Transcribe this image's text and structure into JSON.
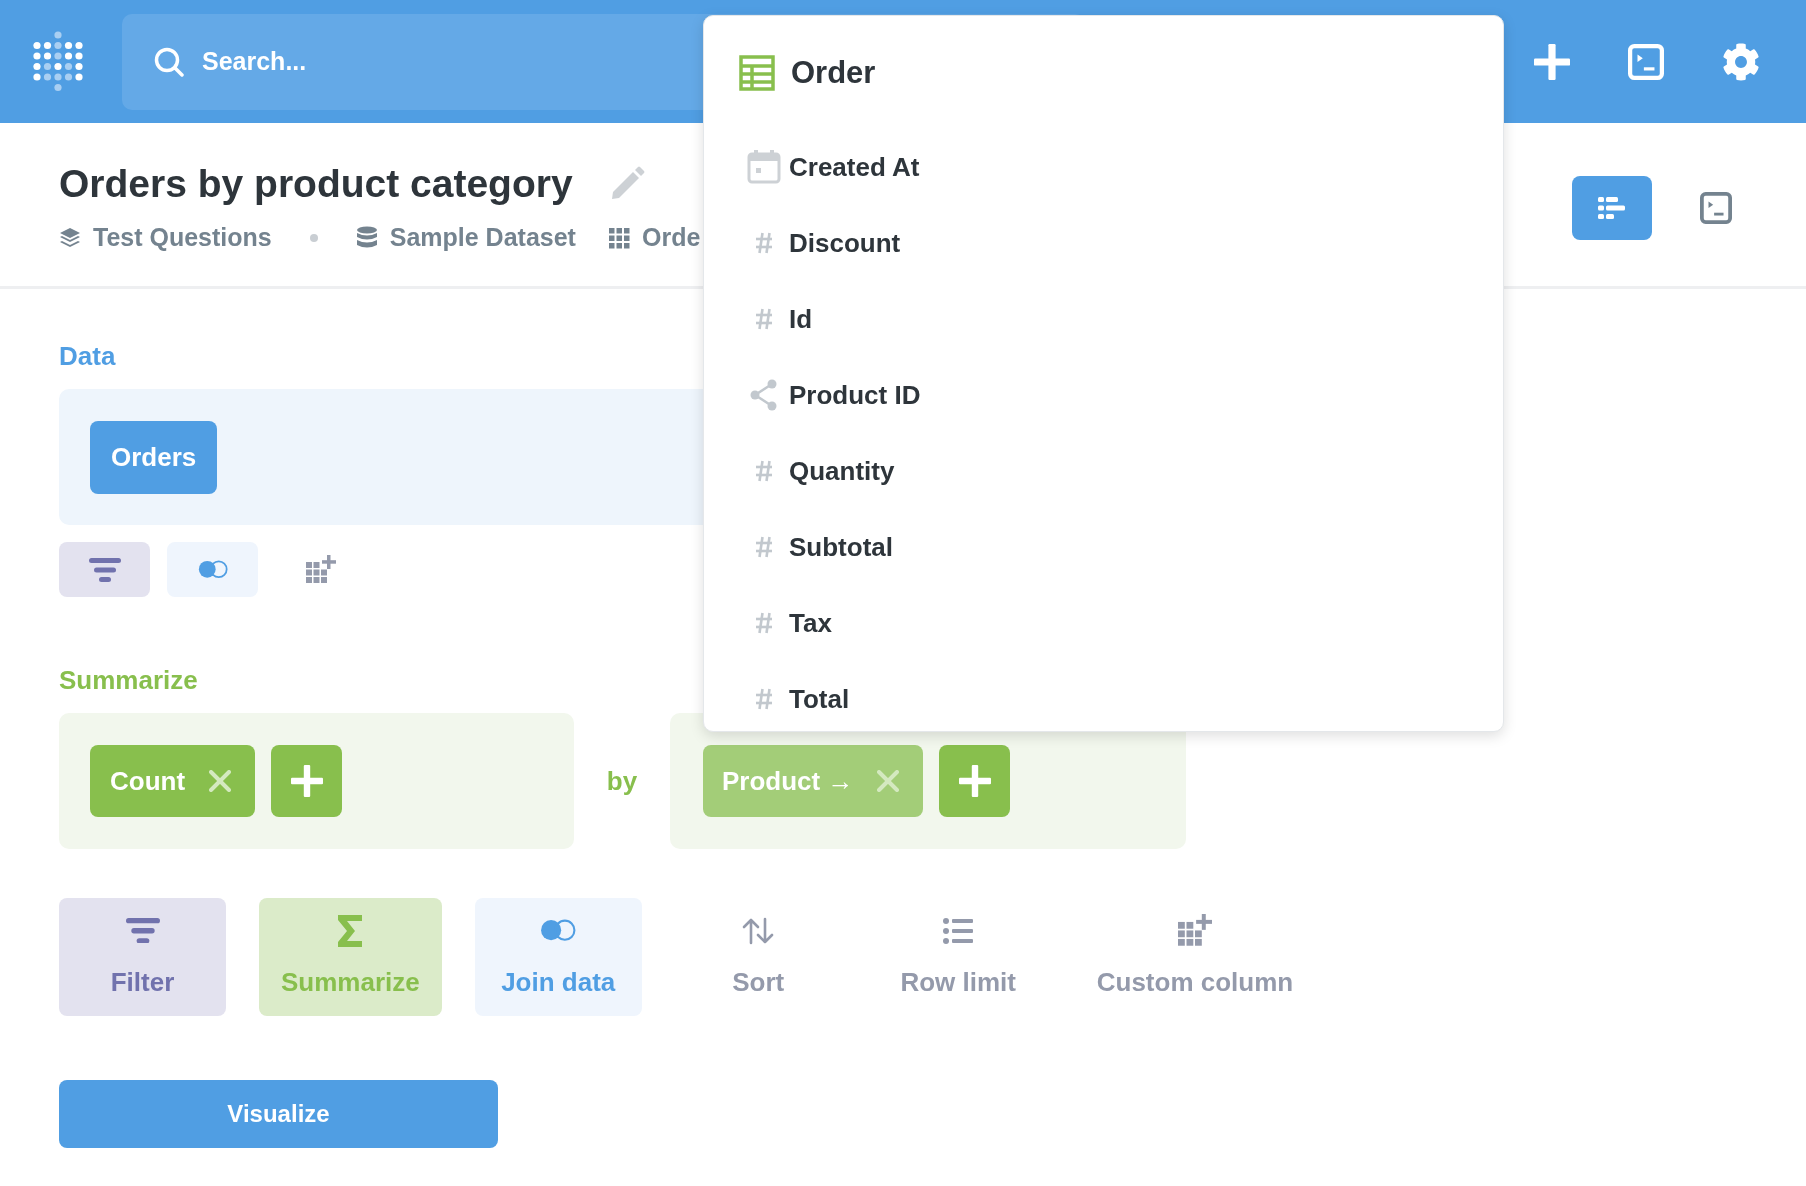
{
  "header": {
    "search": {
      "placeholder": "Search..."
    }
  },
  "question": {
    "title": "Orders by product category",
    "breadcrumbs": [
      {
        "kind": "collection",
        "label": "Test Questions"
      },
      {
        "kind": "database",
        "label": "Sample Dataset"
      },
      {
        "kind": "table",
        "label": "Orde"
      }
    ]
  },
  "view_toggle": [
    {
      "kind": "notebook",
      "selected": true
    },
    {
      "kind": "sql",
      "selected": false
    }
  ],
  "data": {
    "label": "Data",
    "source": "Orders",
    "steps": [
      {
        "kind": "filter"
      },
      {
        "kind": "join"
      },
      {
        "kind": "custom_column"
      }
    ]
  },
  "summarize": {
    "label": "Summarize",
    "metrics": [
      "Count"
    ],
    "by_label": "by",
    "breakouts": [
      "Product →"
    ]
  },
  "actions": [
    {
      "kind": "filter",
      "label": "Filter"
    },
    {
      "kind": "summarize",
      "label": "Summarize"
    },
    {
      "kind": "join",
      "label": "Join data"
    },
    {
      "kind": "sort",
      "label": "Sort"
    },
    {
      "kind": "limit",
      "label": "Row limit"
    },
    {
      "kind": "custom_column",
      "label": "Custom column"
    }
  ],
  "visualize_button": "Visualize",
  "field_picker": {
    "title": "Order",
    "fields": [
      {
        "kind": "date",
        "name": "Created At"
      },
      {
        "kind": "number",
        "name": "Discount"
      },
      {
        "kind": "number",
        "name": "Id"
      },
      {
        "kind": "foreign_key",
        "name": "Product ID"
      },
      {
        "kind": "number",
        "name": "Quantity"
      },
      {
        "kind": "number",
        "name": "Subtotal"
      },
      {
        "kind": "number",
        "name": "Tax"
      },
      {
        "kind": "number",
        "name": "Total"
      }
    ]
  }
}
